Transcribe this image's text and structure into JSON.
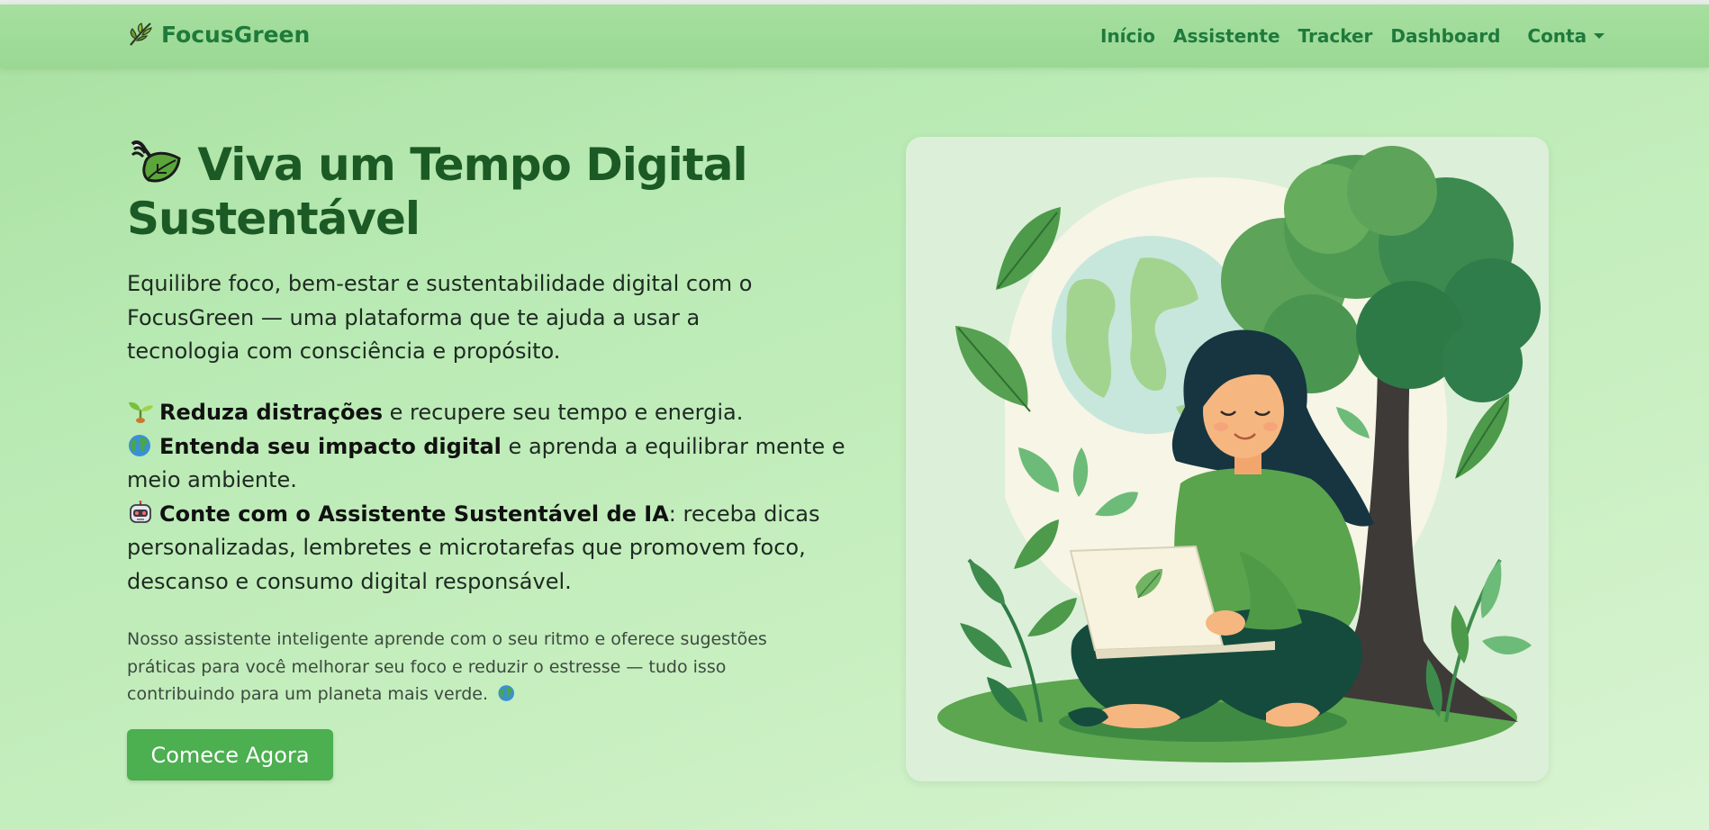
{
  "brand": {
    "name": "FocusGreen",
    "icon": "leaf-icon"
  },
  "nav": {
    "items": [
      "Início",
      "Assistente",
      "Tracker",
      "Dashboard"
    ],
    "account": "Conta"
  },
  "hero": {
    "title_line1": "Viva um Tempo Digital",
    "title_line2": "Sustentável",
    "lead": "Equilibre foco, bem-estar e sustentabilidade digital com o FocusGreen — uma plataforma que te ajuda a usar a tecnologia com consciência e propósito.",
    "features": [
      {
        "icon": "seedling-icon",
        "bold": "Reduza distrações",
        "rest": " e recupere seu tempo e energia."
      },
      {
        "icon": "globe-icon",
        "bold": "Entenda seu impacto digital",
        "rest": " e aprenda a equilibrar mente e meio ambiente."
      },
      {
        "icon": "robot-icon",
        "bold": "Conte com o Assistente Sustentável de IA",
        "rest": ": receba dicas personalizadas, lembretes e microtarefas que promovem foco, descanso e consumo digital responsável."
      }
    ],
    "small_text": "Nosso assistente inteligente aprende com o seu ritmo e oferece sugestões práticas para você melhorar seu foco e reduzir o estresse — tudo isso contribuindo para um planeta mais verde.",
    "cta": "Comece Agora"
  },
  "colors": {
    "accent": "#4caf50",
    "brand": "#1e7b3a",
    "title": "#1c5a25"
  }
}
